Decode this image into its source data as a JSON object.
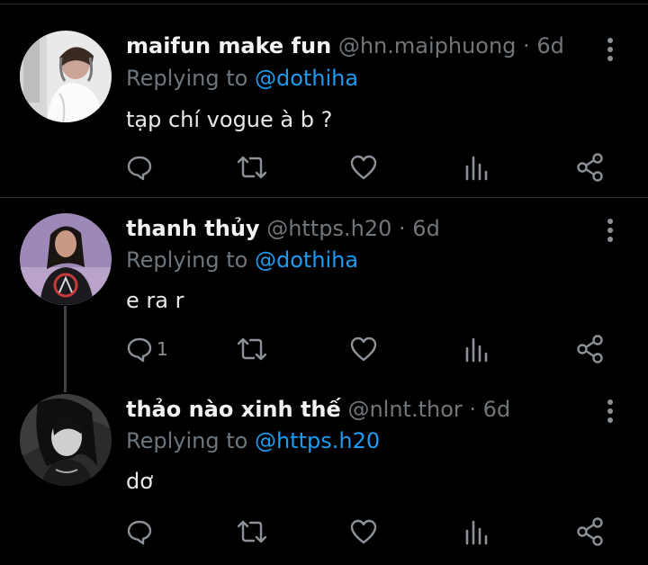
{
  "replies": [
    {
      "name": "maifun make fun",
      "handle": "@hn.maiphuong",
      "separator": "·",
      "time": "6d",
      "replying_prefix": "Replying to",
      "replying_to": "@dothiha",
      "text": "tạp chí vogue à b ?",
      "reply_count": ""
    },
    {
      "name": "thanh thủy",
      "handle": "@https.h20",
      "separator": "·",
      "time": "6d",
      "replying_prefix": "Replying to",
      "replying_to": "@dothiha",
      "text": "e ra r",
      "reply_count": "1"
    },
    {
      "name": "thảo nào xinh thế",
      "handle": "@nlnt.thor",
      "separator": "·",
      "time": "6d",
      "replying_prefix": "Replying to",
      "replying_to": "@https.h20",
      "text": "dơ",
      "reply_count": ""
    }
  ],
  "icons": {
    "reply": "comment-icon",
    "retweet": "retweet-icon",
    "like": "heart-icon",
    "views": "analytics-icon",
    "share": "share-icon",
    "more": "more-vertical-icon"
  },
  "colors": {
    "background": "#000000",
    "link": "#1d9bf0",
    "muted": "#71767b",
    "icon": "#8b9196"
  }
}
